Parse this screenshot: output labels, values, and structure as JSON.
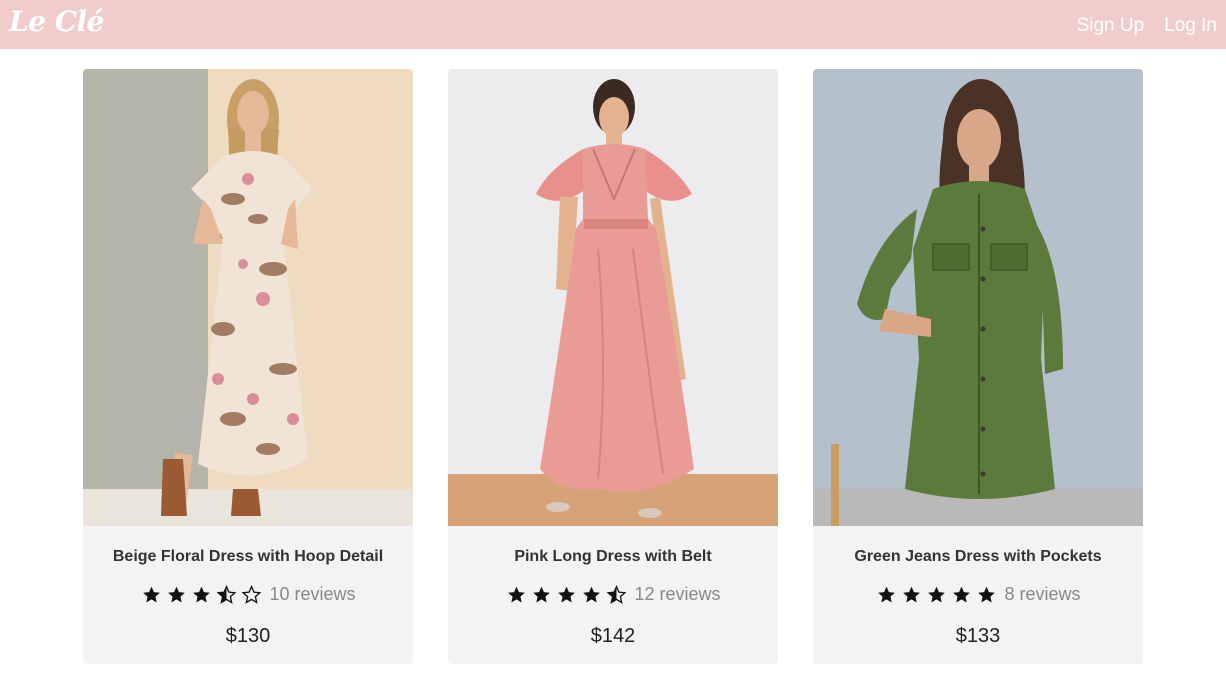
{
  "brand": {
    "logo_text": "Le Clé"
  },
  "nav": {
    "signup_label": "Sign Up",
    "login_label": "Log In"
  },
  "colors": {
    "navbar": "#f0cccb",
    "card_bg": "#f3f3f3",
    "star": "#111111"
  },
  "products": [
    {
      "title": "Beige Floral Dress with Hoop Detail",
      "rating": 3.5,
      "reviews": "10 reviews",
      "price": "$130",
      "image": "woman-in-floral-maxi-dress-photo"
    },
    {
      "title": "Pink Long Dress with Belt",
      "rating": 4.5,
      "reviews": "12 reviews",
      "price": "$142",
      "image": "woman-in-pink-long-dress-photo"
    },
    {
      "title": "Green Jeans Dress with Pockets",
      "rating": 5,
      "reviews": "8 reviews",
      "price": "$133",
      "image": "woman-in-green-shirt-dress-photo"
    }
  ]
}
